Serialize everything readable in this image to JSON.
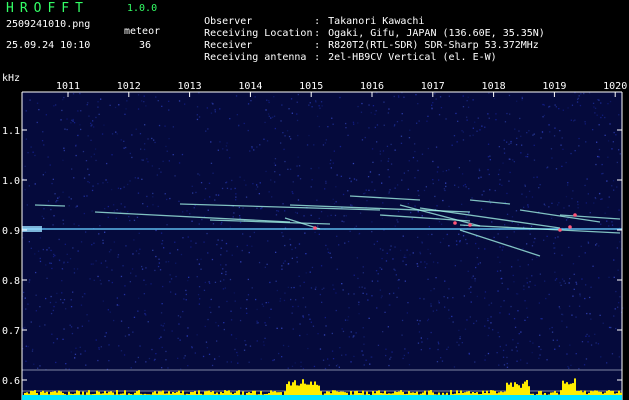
{
  "header": {
    "app_title": "HROFFT",
    "app_version": "1.0.0",
    "file_name": "2509241010.png",
    "datetime": "25.09.24 10:10",
    "meteor_label": "meteor",
    "meteor_count": "36",
    "info": [
      {
        "key": "Observer",
        "value": "Takanori Kawachi"
      },
      {
        "key": "Receiving Location",
        "value": "Ogaki, Gifu, JAPAN (136.60E, 35.35N)"
      },
      {
        "key": "Receiver",
        "value": "R820T2(RTL-SDR) SDR-Sharp 53.372MHz"
      },
      {
        "key": "Receiving antenna",
        "value": "2el-HB9CV Vertical (el. E-W)"
      }
    ]
  },
  "plot": {
    "y_unit": "kHz",
    "x_ticks": [
      "1011",
      "1012",
      "1013",
      "1014",
      "1015",
      "1016",
      "1017",
      "1018",
      "1019",
      "1020"
    ],
    "y_ticks": [
      "1.1",
      "1.0",
      "0.9",
      "0.8",
      "0.7",
      "0.6"
    ],
    "colors": {
      "background": "#050a3c",
      "carrier": "#66ccff",
      "meteor_trail": "#aaffee",
      "meteor_head": "#ff5577",
      "grid_line": "#ffffff",
      "axis": "#ffffff",
      "power_yellow": "#ffee00",
      "power_cyan": "#00e5ff"
    }
  }
}
